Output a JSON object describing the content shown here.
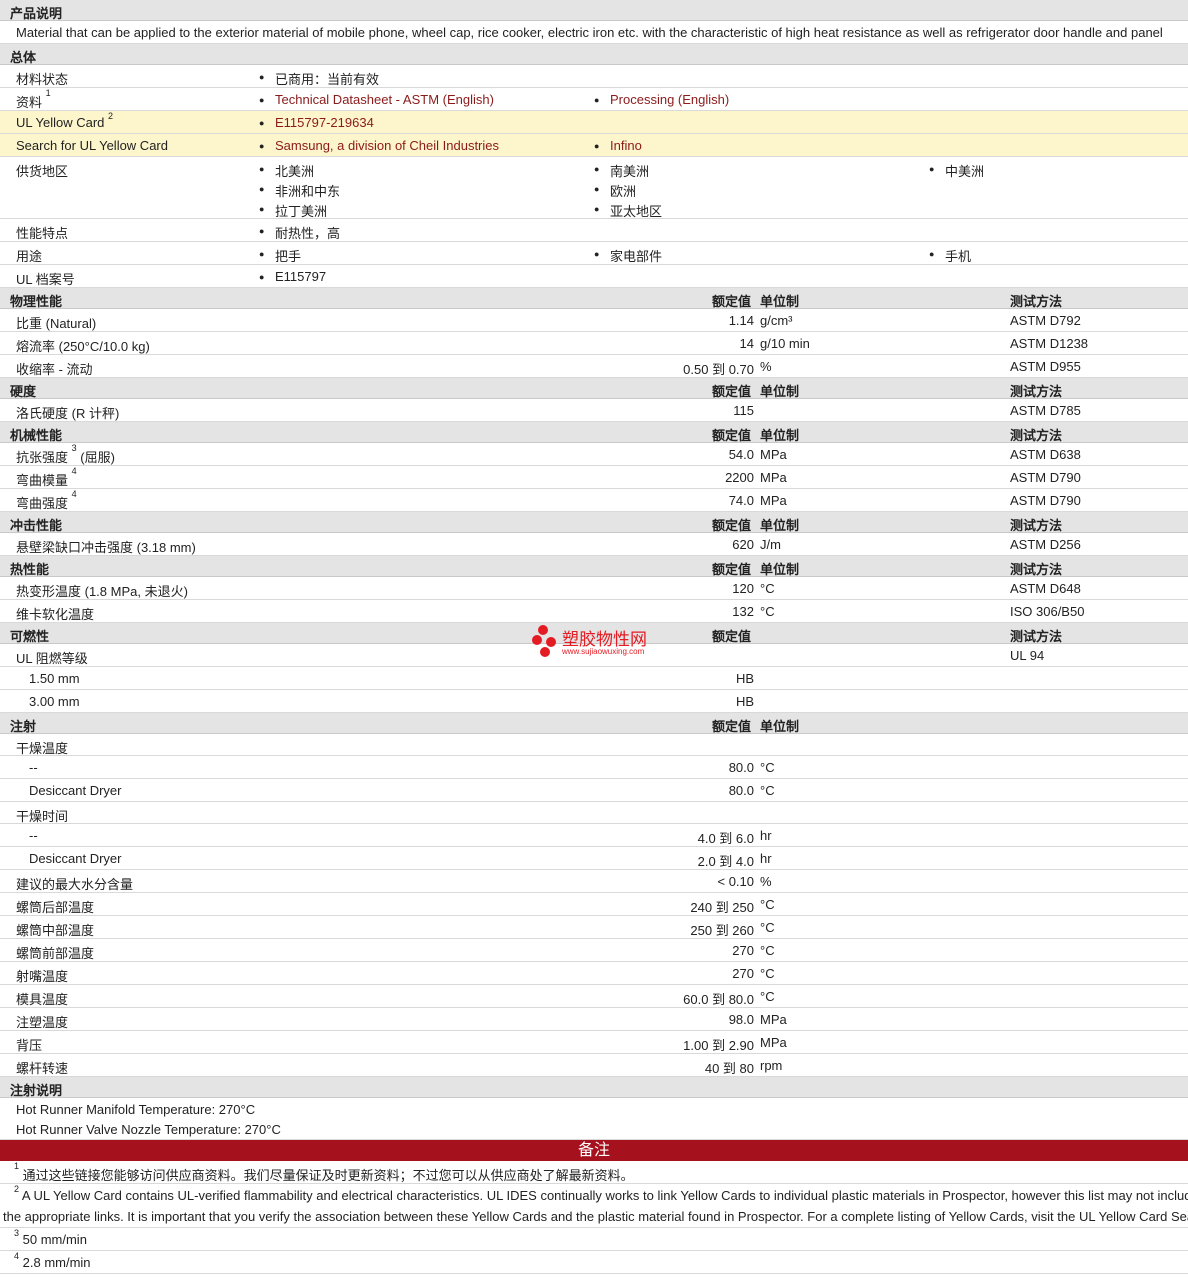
{
  "sections": {
    "product_desc": "产品说明",
    "general": "总体",
    "physical": "物理性能",
    "hardness": "硬度",
    "mechanical": "机械性能",
    "impact": "冲击性能",
    "thermal": "热性能",
    "flammability": "可燃性",
    "injection": "注射",
    "injection_notes": "注射说明",
    "notes": "备注"
  },
  "col": {
    "nominal": "额定值",
    "unit": "单位制",
    "method": "测试方法"
  },
  "description": "Material that can be applied to the exterior material of mobile phone, wheel cap, rice cooker, electric iron etc. with the characteristic of high heat resistance as well as refrigerator door handle and panel",
  "general": {
    "status_label": "材料状态",
    "status_value": "已商用：当前有效",
    "docs_label": "资料",
    "docs_sup": "1",
    "doc1": "Technical Datasheet - ASTM (English)",
    "doc2": "Processing (English)",
    "ulcard_label": "UL Yellow Card",
    "ulcard_sup": "2",
    "ulcard_value": "E115797-219634",
    "search_label": "Search for UL Yellow Card",
    "search1": "Samsung, a division of Cheil Industries",
    "search2": "Infino",
    "supply_label": "供货地区",
    "supply": [
      "北美洲",
      "南美洲",
      "中美洲",
      "非洲和中东",
      "欧洲",
      "拉丁美洲",
      "亚太地区"
    ],
    "feature_label": "性能特点",
    "feature_value": "耐热性，高",
    "use_label": "用途",
    "uses": [
      "把手",
      "家电部件",
      "手机"
    ],
    "ulfile_label": "UL 档案号",
    "ulfile_value": "E115797"
  },
  "physical": [
    {
      "name": "比重  (Natural)",
      "val": "1.14",
      "unit": "g/cm³",
      "method": "ASTM D792"
    },
    {
      "name": "熔流率  (250°C/10.0 kg)",
      "val": "14",
      "unit": "g/10 min",
      "method": "ASTM D1238"
    },
    {
      "name": "收缩率  - 流动",
      "val": "0.50 到  0.70",
      "unit": "%",
      "method": "ASTM D955"
    }
  ],
  "hardness": [
    {
      "name": "洛氏硬度  (R 计秤)",
      "val": "115",
      "unit": "",
      "method": "ASTM D785"
    }
  ],
  "mechanical": [
    {
      "name": "抗张强度",
      "sup": "3",
      "suffix": " (屈服)",
      "val": "54.0",
      "unit": "MPa",
      "method": "ASTM D638"
    },
    {
      "name": "弯曲模量",
      "sup": "4",
      "suffix": "",
      "val": "2200",
      "unit": "MPa",
      "method": "ASTM D790"
    },
    {
      "name": "弯曲强度",
      "sup": "4",
      "suffix": "",
      "val": "74.0",
      "unit": "MPa",
      "method": "ASTM D790"
    }
  ],
  "impact": [
    {
      "name": "悬壁梁缺口冲击强度  (3.18 mm)",
      "val": "620",
      "unit": "J/m",
      "method": "ASTM D256"
    }
  ],
  "thermal": [
    {
      "name": "热变形温度  (1.8 MPa, 未退火)",
      "val": "120",
      "unit": "°C",
      "method": "ASTM D648"
    },
    {
      "name": "维卡软化温度",
      "val": "132",
      "unit": "°C",
      "method": "ISO 306/B50"
    }
  ],
  "flammability": {
    "rating_label": "UL 阻燃等级",
    "rating_method": "UL 94",
    "rows": [
      {
        "name": "1.50 mm",
        "val": "HB"
      },
      {
        "name": "3.00 mm",
        "val": "HB"
      }
    ]
  },
  "injection": [
    {
      "name": "干燥温度",
      "val": "",
      "unit": "",
      "indent": false
    },
    {
      "name": "--",
      "val": "80.0",
      "unit": "°C",
      "indent": true
    },
    {
      "name": "Desiccant Dryer",
      "val": "80.0",
      "unit": "°C",
      "indent": true
    },
    {
      "name": "干燥时间",
      "val": "",
      "unit": "",
      "indent": false
    },
    {
      "name": "--",
      "val": "4.0 到  6.0",
      "unit": "hr",
      "indent": true
    },
    {
      "name": "Desiccant Dryer",
      "val": "2.0 到  4.0",
      "unit": "hr",
      "indent": true
    },
    {
      "name": "建议的最大水分含量",
      "val": "< 0.10",
      "unit": "%",
      "indent": false
    },
    {
      "name": "螺筒后部温度",
      "val": "240 到  250",
      "unit": "°C",
      "indent": false
    },
    {
      "name": "螺筒中部温度",
      "val": "250 到  260",
      "unit": "°C",
      "indent": false
    },
    {
      "name": "螺筒前部温度",
      "val": "270",
      "unit": "°C",
      "indent": false
    },
    {
      "name": "射嘴温度",
      "val": "270",
      "unit": "°C",
      "indent": false
    },
    {
      "name": "模具温度",
      "val": "60.0 到  80.0",
      "unit": "°C",
      "indent": false
    },
    {
      "name": "注塑温度",
      "val": "98.0",
      "unit": "MPa",
      "indent": false
    },
    {
      "name": "背压",
      "val": "1.00 到  2.90",
      "unit": "MPa",
      "indent": false
    },
    {
      "name": "螺杆转速",
      "val": "40 到  80",
      "unit": "rpm",
      "indent": false
    }
  ],
  "injection_notes": [
    "Hot Runner Manifold Temperature: 270°C",
    "Hot Runner Valve Nozzle Temperature: 270°C"
  ],
  "footnotes": [
    {
      "sup": "1",
      "text": "通过这些链接您能够访问供应商资料。我们尽量保证及时更新资料；不过您可以从供应商处了解最新资料。"
    },
    {
      "sup": "2",
      "text": "A UL Yellow Card contains UL-verified flammability and electrical characteristics. UL IDES continually works to link Yellow Cards to individual plastic materials in Prospector, however this list may not include all of",
      "text2": "the appropriate links. It is important that you verify the association between these Yellow Cards and the plastic material found in Prospector. For a complete listing of Yellow Cards, visit the UL Yellow Card Search."
    },
    {
      "sup": "3",
      "text": "50 mm/min"
    },
    {
      "sup": "4",
      "text": "2.8 mm/min"
    }
  ],
  "watermark": {
    "title": "塑胶物性网",
    "url": "www.sujiaowuxing.com"
  }
}
